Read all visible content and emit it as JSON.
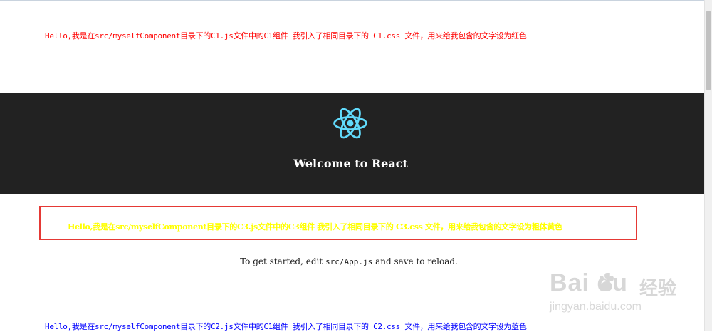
{
  "content": {
    "c1_text": "Hello,我是在src/myselfComponent目录下的C1.js文件中的C1组件 我引入了相同目录下的 C1.css 文件，用来给我包含的文字设为红色",
    "c3_text": "Hello,我是在src/myselfComponent目录下的C3.js文件中的C3组件 我引入了相同目录下的 C3.css 文件，用来给我包含的文字设为粗体黄色",
    "c2_text": "Hello,我是在src/myselfComponent目录下的C2.js文件中的C1组件 我引入了相同目录下的 C2.css 文件，用来给我包含的文字设为蓝色"
  },
  "header": {
    "logo_icon": "react-logo-icon",
    "title": "Welcome to React"
  },
  "intro": {
    "prefix": "To get started, edit ",
    "code": "src/App.js",
    "suffix": " and save to reload."
  },
  "watermark": {
    "brand": "Bai du",
    "jingyan": "经验",
    "url": "jingyan.baidu.com"
  },
  "colors": {
    "c1_text": "#ff0000",
    "c2_text": "#0000ff",
    "c3_text": "#ffff00",
    "header_bg": "#222222",
    "react_logo": "#61dafb",
    "highlight_box": "#e53935"
  }
}
